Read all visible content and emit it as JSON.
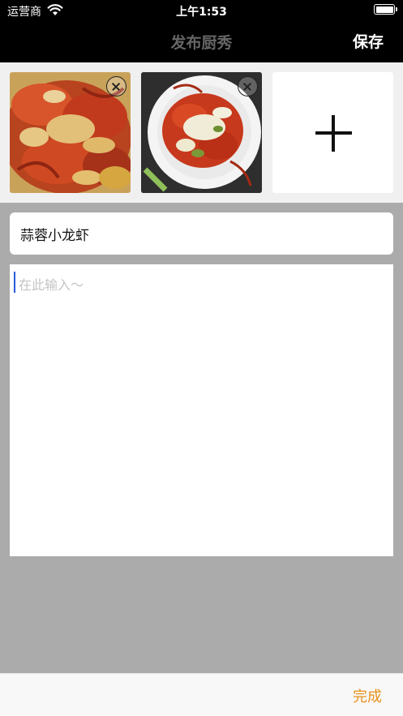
{
  "status_bar": {
    "carrier": "运营商",
    "time": "上午1:53"
  },
  "nav": {
    "title": "发布厨秀",
    "save_label": "保存"
  },
  "photos": {
    "items": [
      {
        "name": "photo-1",
        "depicts": "garlic crayfish dish"
      },
      {
        "name": "photo-2",
        "depicts": "crayfish on white plate"
      }
    ],
    "add_icon": "plus-icon",
    "remove_icon": "close-circle-icon"
  },
  "form": {
    "title_value": "蒜蓉小龙虾",
    "content_placeholder": "在此输入～"
  },
  "toolbar": {
    "done_label": "完成"
  },
  "colors": {
    "accent": "#e8921e",
    "caret": "#2b59d9",
    "backdrop": "#ababab"
  }
}
